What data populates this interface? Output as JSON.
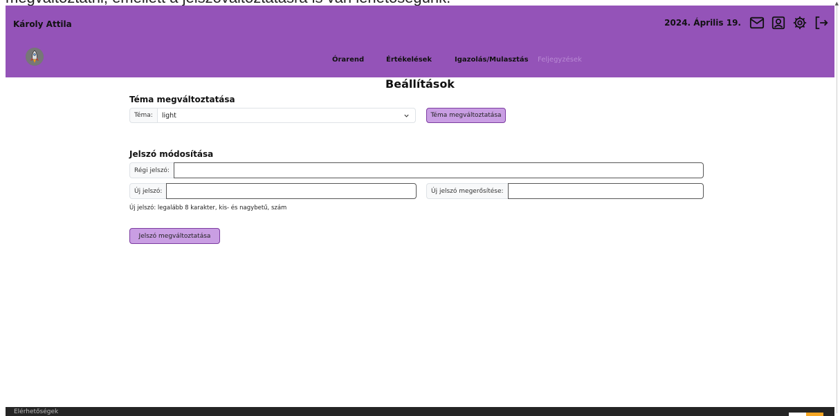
{
  "caption": "megváltoztatni, emellett a jelszóváltoztatásra is van lehetőségünk.",
  "header": {
    "user_name": "Károly Attila",
    "date": "2024. Április 19.",
    "icons": [
      "mail-icon",
      "profile-icon",
      "settings-icon",
      "logout-icon"
    ]
  },
  "nav": {
    "items": [
      {
        "label": "Órarend",
        "enabled": true
      },
      {
        "label": "Értékelések",
        "enabled": true
      },
      {
        "label": "Igazolás/Mulasztás",
        "enabled": true
      },
      {
        "label": "Feljegyzések",
        "enabled": false
      }
    ]
  },
  "page_title": "Beállítások",
  "theme": {
    "section_title": "Téma megváltoztatása",
    "label": "Téma:",
    "selected": "light",
    "button_label": "Téma megváltoztatása"
  },
  "password": {
    "section_title": "Jelszó módosítása",
    "old_label": "Régi jelszó:",
    "new_label": "Új jelszó:",
    "confirm_label": "Új jelszó megerősítése:",
    "old_value": "",
    "new_value": "",
    "confirm_value": "",
    "hint": "Új jelszó: legalább 8 karakter, kis- és nagybetű, szám",
    "button_label": "Jelszó megváltoztatása"
  },
  "footer": {
    "link": "Elérhetőségek"
  },
  "colors": {
    "header_bg": "#9453b8",
    "button_bg": "#c99ee3",
    "button_border": "#7b3aa0",
    "footer_bg": "#252525"
  }
}
